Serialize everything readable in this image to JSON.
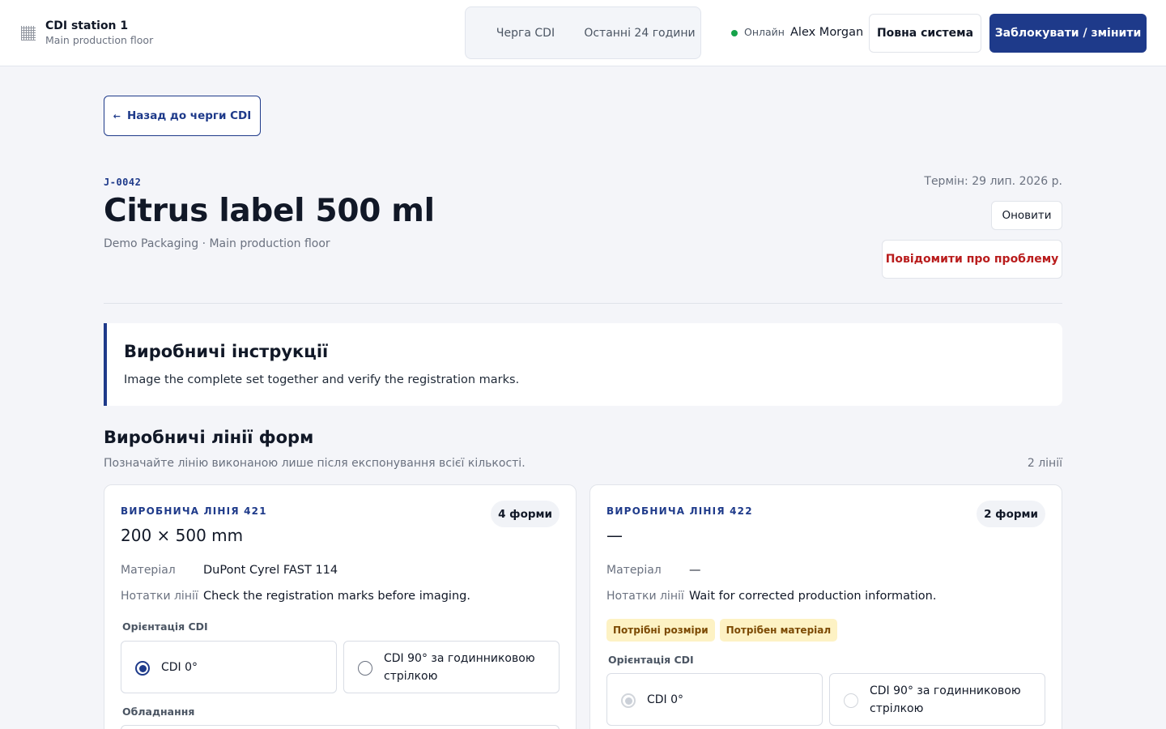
{
  "header": {
    "station_title": "CDI station 1",
    "station_subtitle": "Main production floor",
    "station_icon": "grid-icon",
    "tabs": [
      {
        "label": "Черга CDI"
      },
      {
        "label": "Останні 24 години"
      }
    ],
    "status": "Онлайн",
    "status_color": "#16a34a",
    "user_name": "Alex Morgan",
    "full_system_label": "Повна система",
    "lock_label": "Заблокувати / змінити",
    "accent_color": "#1e3a8a"
  },
  "back_label": "Назад до черги CDI",
  "back_icon": "arrow-left-icon",
  "job": {
    "id": "J-0042",
    "title": "Citrus label 500 ml",
    "subtitle": "Demo Packaging · Main production floor",
    "due": "Термін: 29 лип. 2026 р.",
    "refresh_label": "Оновити",
    "report_label": "Повідомити про проблему"
  },
  "instructions": {
    "title": "Виробничі інструкції",
    "text": "Image the complete set together and verify the registration marks."
  },
  "lines_section": {
    "title": "Виробничі лінії форм",
    "subtitle": "Позначайте лінію виконаною лише після експонування всієї кількості.",
    "count": "2 лінії"
  },
  "lines": [
    {
      "eyebrow": "ВИРОБНИЧА ЛІНІЯ 421",
      "forms": "4 форми",
      "size": "200 × 500 mm",
      "material_label": "Матеріал",
      "material": "DuPont Cyrel FAST 114",
      "notes_label": "Нотатки лінії",
      "notes": "Check the registration marks before imaging.",
      "orientation_label": "Орієнтація CDI",
      "options": [
        "CDI 0°",
        "CDI 90° за годинниковою стрілкою"
      ],
      "selected_option": "CDI 0°",
      "equipment_label": "Обладнання"
    },
    {
      "eyebrow": "ВИРОБНИЧА ЛІНІЯ 422",
      "forms": "2 форми",
      "size": "—",
      "material_label": "Матеріал",
      "material": "—",
      "notes_label": "Нотатки лінії",
      "notes": "Wait for corrected production information.",
      "tags": [
        "Потрібні розміри",
        "Потрібен матеріал"
      ],
      "tag_color": "#fdf2c4",
      "orientation_label": "Орієнтація CDI",
      "options": [
        "CDI 0°",
        "CDI 90° за годинниковою стрілкою"
      ],
      "selected_option": "CDI 0°",
      "options_disabled": true
    }
  ]
}
